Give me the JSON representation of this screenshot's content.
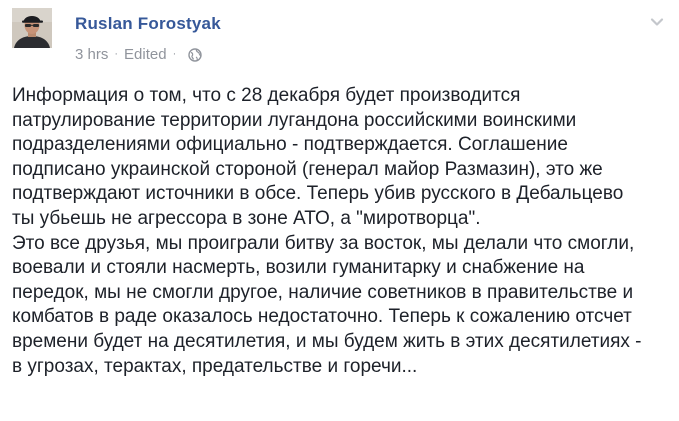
{
  "post": {
    "author": {
      "name": "Ruslan Forostyak",
      "avatar_icon": "profile-photo"
    },
    "meta": {
      "timestamp": "3 hrs",
      "separator": "·",
      "edited_label": "Edited",
      "dot": "·",
      "privacy_icon": "globe-icon"
    },
    "menu_icon": "chevron-down-icon",
    "paragraphs": [
      "Информация о том, что с 28 декабря будет производится\nпатрулирование территории лугандона российскими воинскими\nподразделениями официально - подтверждается. Соглашение\nподписано украинской стороной (генерал майор Размазин), это же\nподтверждают источники в обсе. Теперь убив русского в Дебальцево\nты убьешь не агрессора в зоне АТО, а \"миротворца\".",
      "Это все друзья, мы проиграли битву за восток, мы делали что смогли,\nвоевали и стояли насмерть, возили гуманитарку и снабжение на\nпередок, мы не смогли другое, наличие советников в правительстве и\nкомбатов в раде оказалось недостаточно. Теперь к сожалению отсчет\nвремени будет на десятилетия, и мы будем жить в этих десятилетиях -\nв угрозах, терактах, предательстве и горечи..."
    ]
  },
  "colors": {
    "author_link": "#365899",
    "meta_text": "#90949c",
    "body_text": "#1d2129",
    "background": "#ffffff"
  }
}
